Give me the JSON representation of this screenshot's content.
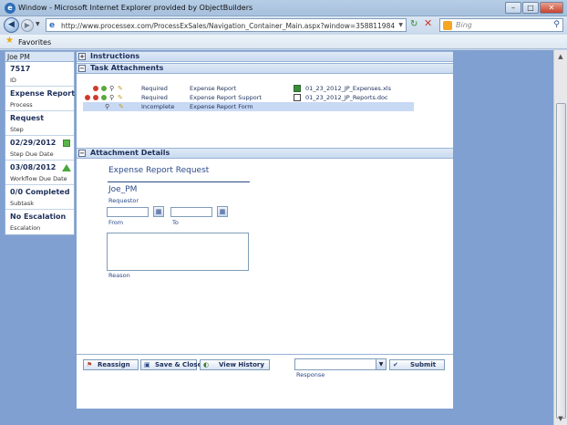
{
  "browser": {
    "window_title": "Window - Microsoft Internet Explorer provided by ObjectBuilders",
    "url": "http://www.processex.com/ProcessExSales/Navigation_Container_Main.aspx?window=358811984",
    "search_placeholder": "Bing",
    "favorites_label": "Favorites",
    "minimize": "–",
    "maximize": "□",
    "close": "✕",
    "back": "◀",
    "forward": "▶",
    "refresh": "↻",
    "stop": "✕",
    "search_go": "⚲"
  },
  "left_panel": {
    "user": "Joe PM",
    "items": [
      {
        "value": "7517",
        "label": "ID"
      },
      {
        "value": "Expense Report",
        "label": "Process"
      },
      {
        "value": "Request",
        "label": "Step"
      },
      {
        "value": "02/29/2012",
        "label": "Step Due Date"
      },
      {
        "value": "03/08/2012",
        "label": "Workflow Due Date"
      },
      {
        "value": "0/0 Completed",
        "label": "Subtask"
      },
      {
        "value": "No Escalation",
        "label": "Escalation"
      }
    ]
  },
  "sections": {
    "instructions": "Instructions",
    "task_attachments": "Task Attachments",
    "attachment_details": "Attachment Details",
    "toggle_plus": "+",
    "toggle_minus": "−"
  },
  "attachments": [
    {
      "status": "Required",
      "name": "Expense Report",
      "file": "01_23_2012_JP_Expenses.xls"
    },
    {
      "status": "Required",
      "name": "Expense Report Support",
      "file": "01_23_2012_JP_Reports.doc"
    },
    {
      "status": "Incomplete",
      "name": "Expense Report Form",
      "file": ""
    }
  ],
  "form": {
    "title": "Expense Report Request",
    "requestor_value": "Joe_PM",
    "requestor_label": "Requestor",
    "from_label": "From",
    "to_label": "To",
    "reason_label": "Reason"
  },
  "actions": {
    "reassign": "Reassign",
    "save_close": "Save & Close",
    "view_history": "View History",
    "submit": "Submit",
    "response_label": "Response"
  }
}
